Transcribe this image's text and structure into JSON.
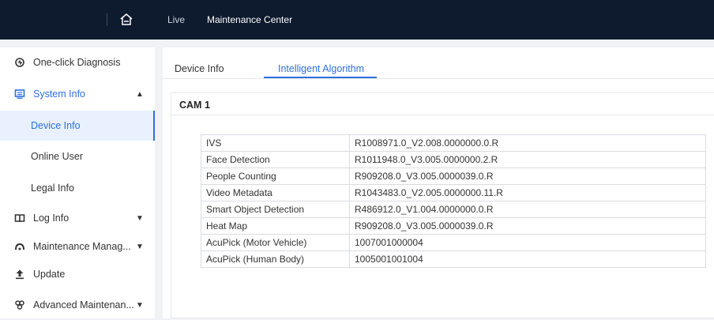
{
  "header": {
    "nav_items": [
      "Live",
      "Maintenance Center"
    ]
  },
  "sidebar": {
    "items": [
      {
        "label": "One-click Diagnosis",
        "icon": "diagnosis-icon"
      },
      {
        "label": "System Info",
        "icon": "monitor-icon",
        "expanded": true
      },
      {
        "label": "Log Info",
        "icon": "book-icon"
      },
      {
        "label": "Maintenance Manag...",
        "icon": "maintenance-icon"
      },
      {
        "label": "Update",
        "icon": "update-icon"
      },
      {
        "label": "Advanced Maintenan...",
        "icon": "advanced-maintenance-icon"
      }
    ],
    "sub_items": [
      "Device Info",
      "Online User",
      "Legal Info"
    ],
    "active_sub_item": "Device Info"
  },
  "tabs": {
    "device_info": "Device Info",
    "intelligent_algorithm": "Intelligent Algorithm",
    "active": "Intelligent Algorithm"
  },
  "panel": {
    "title": "CAM 1",
    "rows": [
      {
        "name": "IVS",
        "version": "R1008971.0_V2.008.0000000.0.R"
      },
      {
        "name": "Face Detection",
        "version": "R1011948.0_V3.005.0000000.2.R"
      },
      {
        "name": "People Counting",
        "version": "R909208.0_V3.005.0000039.0.R"
      },
      {
        "name": "Video Metadata",
        "version": "R1043483.0_V2.005.0000000.11.R"
      },
      {
        "name": "Smart Object Detection",
        "version": "R486912.0_V1.004.0000000.0.R"
      },
      {
        "name": "Heat Map",
        "version": "R909208.0_V3.005.0000039.0.R"
      },
      {
        "name": "AcuPick (Motor Vehicle)",
        "version": "1007001000004"
      },
      {
        "name": "AcuPick (Human Body)",
        "version": "1005001001004"
      }
    ]
  },
  "colors": {
    "accent": "#2f6fe0",
    "topbar": "#0e1a2e"
  }
}
